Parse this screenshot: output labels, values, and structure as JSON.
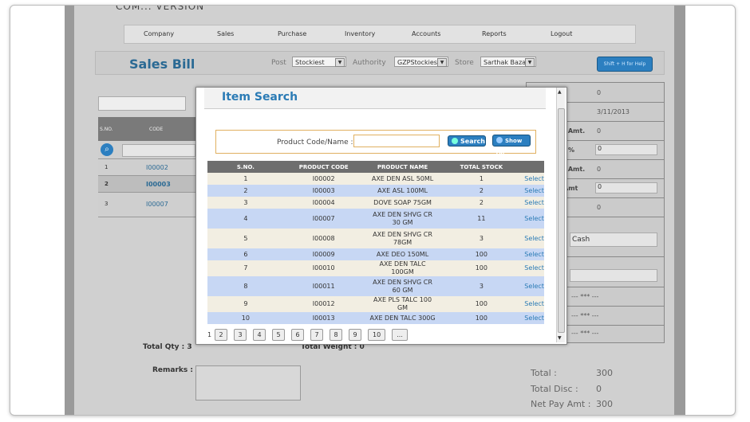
{
  "header": {
    "logo_text": "COM... VERSION"
  },
  "menu": [
    "Company",
    "Sales",
    "Purchase",
    "Inventory",
    "Accounts",
    "Reports",
    "Logout"
  ],
  "sales_bill": {
    "title": "Sales Bill",
    "post_label": "Post",
    "post_value": "Stockiest",
    "authority_label": "Authority",
    "authority_value": "GZPStockies",
    "store_label": "Store",
    "store_value": "Sarthak Baza",
    "help_button": "Shift + H for Help"
  },
  "left_table": {
    "headers": {
      "sno": "S.NO.",
      "code": "CODE"
    },
    "rows": [
      {
        "sno": "1",
        "code": "I00002"
      },
      {
        "sno": "2",
        "code": "I00003"
      },
      {
        "sno": "3",
        "code": "I00007"
      }
    ]
  },
  "right_panel": {
    "val1": "0",
    "date": "3/11/2013",
    "amt_label": ". Amt.",
    "amt_value": "0",
    "pct_label": ": %",
    "pct_value": "0",
    "amt2_label": ". Amt.",
    "amt2_value": "0",
    "amt3_label": "Amt",
    "amt3_value": "0",
    "val_after": "0",
    "payment": "Cash",
    "dash1": "--- *** ---",
    "dash2": "--- *** ---",
    "dash3": "--- *** ---"
  },
  "footer": {
    "total_qty": "Total Qty :  3",
    "total_weight": "Total Weight :  0",
    "remarks_label": "Remarks :",
    "total_label": "Total :",
    "total_value": "300",
    "disc_label": "Total Disc :",
    "disc_value": "0",
    "net_label": "Net Pay Amt :",
    "net_value": "300"
  },
  "modal": {
    "title": "Item Search",
    "search_label": "Product Code/Name :",
    "search_value": "",
    "search_button": "Search",
    "showall_button": "Show All",
    "columns": [
      "S.NO.",
      "PRODUCT CODE",
      "PRODUCT NAME",
      "TOTAL STOCK",
      ""
    ],
    "rows": [
      {
        "sno": "1",
        "code": "I00002",
        "name": "AXE DEN ASL 50ML",
        "stock": "1",
        "action": "Select"
      },
      {
        "sno": "2",
        "code": "I00003",
        "name": "AXE ASL 100ML",
        "stock": "2",
        "action": "Select"
      },
      {
        "sno": "3",
        "code": "I00004",
        "name": "DOVE SOAP 75GM",
        "stock": "2",
        "action": "Select"
      },
      {
        "sno": "4",
        "code": "I00007",
        "name": "AXE DEN SHVG CR 30 GM",
        "stock": "11",
        "action": "Select"
      },
      {
        "sno": "5",
        "code": "I00008",
        "name": "AXE DEN SHVG CR 78GM",
        "stock": "3",
        "action": "Select"
      },
      {
        "sno": "6",
        "code": "I00009",
        "name": "AXE DEO 150ML",
        "stock": "100",
        "action": "Select"
      },
      {
        "sno": "7",
        "code": "I00010",
        "name": "AXE DEN TALC 100GM",
        "stock": "100",
        "action": "Select"
      },
      {
        "sno": "8",
        "code": "I00011",
        "name": "AXE DEN SHVG CR 60 GM",
        "stock": "3",
        "action": "Select"
      },
      {
        "sno": "9",
        "code": "I00012",
        "name": "AXE PLS TALC 100 GM",
        "stock": "100",
        "action": "Select"
      },
      {
        "sno": "10",
        "code": "I00013",
        "name": "AXE DEN TALC 300G",
        "stock": "100",
        "action": "Select"
      }
    ],
    "pager": {
      "current": "1",
      "pages": [
        "2",
        "3",
        "4",
        "5",
        "6",
        "7",
        "8",
        "9",
        "10",
        "..."
      ]
    }
  },
  "colors": {
    "accent": "#2c7fc0",
    "title_blue": "#2b6a94",
    "row_blue": "#c7d7f4",
    "row_cream": "#f2eee2"
  }
}
